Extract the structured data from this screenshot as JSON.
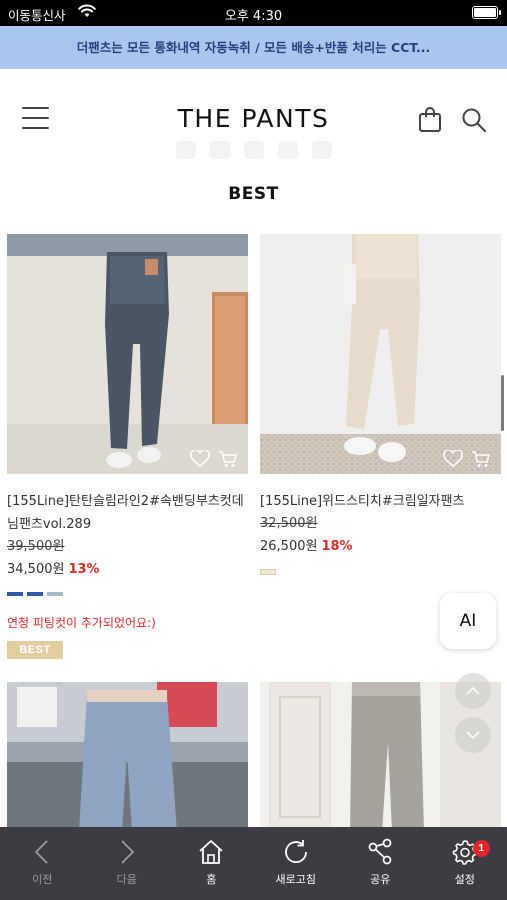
{
  "status_bar": {
    "carrier": "이동통신사",
    "time": "오후 4:30"
  },
  "notice": {
    "text": "더팬츠는 모든 통화내역 자동녹취 / 모든 배송+반품 처리는 CCT..."
  },
  "header": {
    "logo": "THE PANTS",
    "icons": [
      "menu-icon",
      "shopping-bag-icon",
      "search-icon"
    ]
  },
  "section": {
    "title": "BEST"
  },
  "products": [
    {
      "name": "[155Line]탄탄슬림라인2#속밴딩부츠컷데님팬츠vol.289",
      "original_price": "39,500원",
      "price": "34,500원",
      "discount": "13%",
      "swatches": [
        "#2f5aa8",
        "#2f5aa8",
        "#a9b7cc"
      ],
      "promo": "연청 피팅컷이 추가되었어요:)",
      "badge": "BEST"
    },
    {
      "name": "[155Line]위드스티치#크림일자팬츠",
      "original_price": "32,500원",
      "price": "26,500원",
      "discount": "18%",
      "swatches": [
        "#efe8cf"
      ]
    }
  ],
  "floating": {
    "ai_label": "AI"
  },
  "bottom_nav": {
    "items": [
      {
        "label": "이전",
        "icon": "chevron-left-icon"
      },
      {
        "label": "다음",
        "icon": "chevron-right-icon"
      },
      {
        "label": "홈",
        "icon": "home-icon"
      },
      {
        "label": "새로고침",
        "icon": "refresh-icon"
      },
      {
        "label": "공유",
        "icon": "share-icon"
      },
      {
        "label": "설정",
        "icon": "gear-icon",
        "badge": "1"
      }
    ]
  },
  "colors": {
    "notice_bg": "#a9c7ee",
    "discount": "#e02a2a",
    "nav_bg": "#3b3d42",
    "badge_bg": "#e3cca0"
  }
}
